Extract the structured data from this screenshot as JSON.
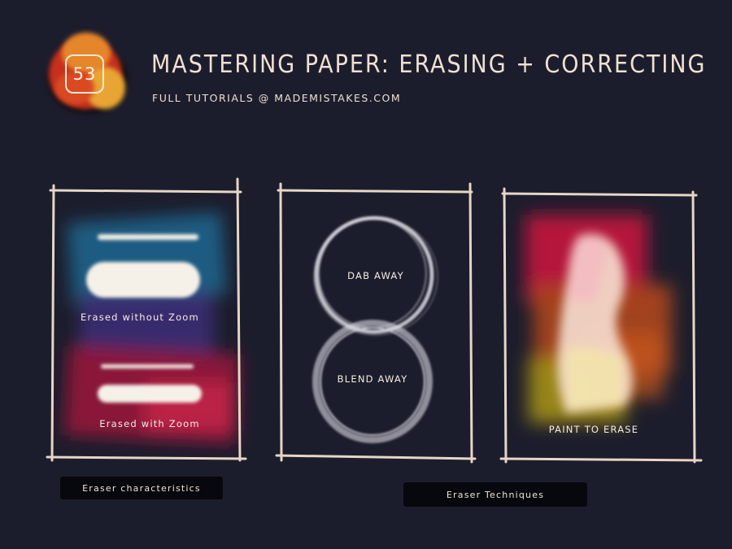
{
  "header": {
    "logo_number": "53",
    "title": "MASTERING PAPER: ERASING + CORRECTING",
    "subtitle": "FULL TUTORIALS @ MADEMISTAKES.COM"
  },
  "panels": [
    {
      "id": "eraser-characteristics",
      "labels": [
        "Erased without Zoom",
        "Erased with Zoom"
      ]
    },
    {
      "id": "eraser-techniques-circles",
      "labels": [
        "DAB AWAY",
        "BLEND AWAY"
      ]
    },
    {
      "id": "paint-to-erase",
      "labels": [
        "PAINT TO ERASE"
      ]
    }
  ],
  "captions": {
    "left": "Eraser characteristics",
    "right": "Eraser Techniques"
  },
  "colors": {
    "background": "#1c1d2c",
    "frame": "#e6d6c6",
    "text": "#efe3d6",
    "caption_bg": "#07080d"
  }
}
